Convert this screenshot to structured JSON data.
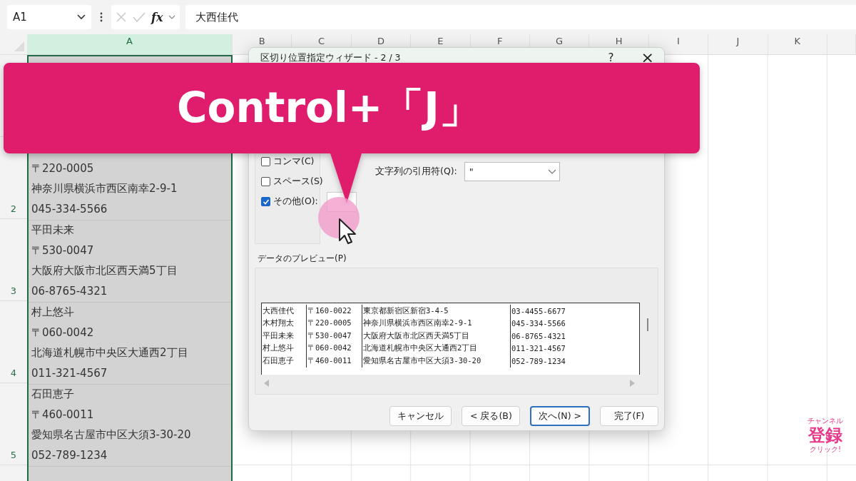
{
  "formula_bar": {
    "name_box": "A1",
    "function_label": "fx",
    "formula": "大西佳代"
  },
  "columns": [
    {
      "label": "A",
      "selected": true
    },
    {
      "label": "B",
      "selected": false
    },
    {
      "label": "C",
      "selected": false
    },
    {
      "label": "D",
      "selected": false
    },
    {
      "label": "E",
      "selected": false
    },
    {
      "label": "F",
      "selected": false
    },
    {
      "label": "G",
      "selected": false
    },
    {
      "label": "H",
      "selected": false
    },
    {
      "label": "I",
      "selected": false
    },
    {
      "label": "J",
      "selected": false
    },
    {
      "label": "K",
      "selected": false
    }
  ],
  "rows": [
    {
      "number": "2",
      "lines": [
        "〒220-0005",
        "神奈川県横浜市西区南幸2-9-1",
        "045-334-5566"
      ]
    },
    {
      "number": "3",
      "lines": [
        "平田未来",
        "〒530-0047",
        "大阪府大阪市北区西天満5丁目",
        "06-8765-4321"
      ]
    },
    {
      "number": "4",
      "lines": [
        "村上悠斗",
        "〒060-0042",
        "北海道札幌市中央区大通西2丁目",
        "011-321-4567"
      ]
    },
    {
      "number": "5",
      "lines": [
        "石田恵子",
        "〒460-0011",
        "愛知県名古屋市中区大須3-30-20",
        "052-789-1234"
      ]
    }
  ],
  "dialog": {
    "title": "区切り位置指定ウィザード - 2 / 3",
    "help": "?",
    "close": "×",
    "delimiters": [
      {
        "label": "コンマ(C)",
        "checked": false,
        "kind": "checkbox"
      },
      {
        "label": "スペース(S)",
        "checked": false,
        "kind": "checkbox"
      },
      {
        "label": "その他(O):",
        "checked": true,
        "kind": "checkbox-with-field"
      }
    ],
    "qualifier": {
      "label": "文字列の引用符(Q):",
      "value": "\""
    },
    "preview": {
      "label": "データのプレビュー(P)",
      "rows": [
        [
          "大西佳代",
          "〒160-0022",
          "東京都新宿区新宿3-4-5",
          "03-4455-6677"
        ],
        [
          "木村翔太",
          "〒220-0005",
          "神奈川県横浜市西区南幸2-9-1",
          "045-334-5566"
        ],
        [
          "平田未来",
          "〒530-0047",
          "大阪府大阪市北区西天満5丁目",
          "06-8765-4321"
        ],
        [
          "村上悠斗",
          "〒060-0042",
          "北海道札幌市中央区大通西2丁目",
          "011-321-4567"
        ],
        [
          "石田恵子",
          "〒460-0011",
          "愛知県名古屋市中区大須3-30-20",
          "052-789-1234"
        ]
      ]
    },
    "buttons": [
      {
        "label": "キャンセル",
        "default": false
      },
      {
        "label": "< 戻る(B)",
        "default": false
      },
      {
        "label": "次へ(N) >",
        "default": true
      },
      {
        "label": "完了(F)",
        "default": false
      }
    ]
  },
  "callout": {
    "text": "Control+「J」"
  },
  "subscribe_badge": {
    "top": "チャンネル",
    "main": "登録",
    "bottom": "クリック!"
  }
}
